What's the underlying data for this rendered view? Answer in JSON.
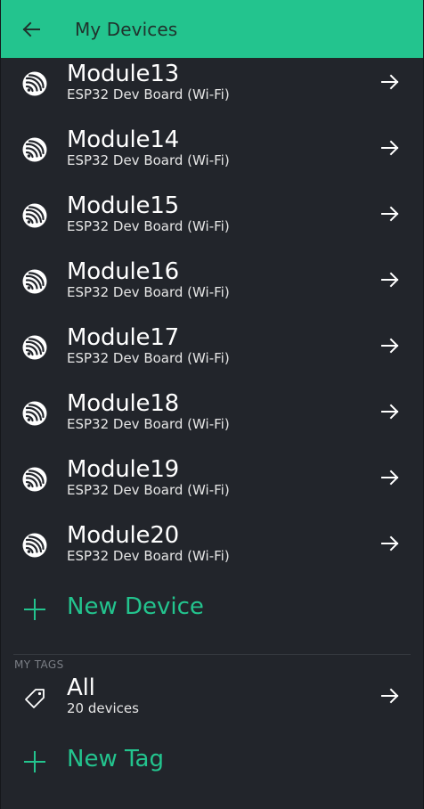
{
  "header": {
    "title": "My Devices",
    "back_icon": "arrow-left-icon",
    "background_color": "#23c48e",
    "title_color": "#20332d"
  },
  "devices": [
    {
      "name": "Module13",
      "board": "ESP32 Dev Board (Wi-Fi)"
    },
    {
      "name": "Module14",
      "board": "ESP32 Dev Board (Wi-Fi)"
    },
    {
      "name": "Module15",
      "board": "ESP32 Dev Board (Wi-Fi)"
    },
    {
      "name": "Module16",
      "board": "ESP32 Dev Board (Wi-Fi)"
    },
    {
      "name": "Module17",
      "board": "ESP32 Dev Board (Wi-Fi)"
    },
    {
      "name": "Module18",
      "board": "ESP32 Dev Board (Wi-Fi)"
    },
    {
      "name": "Module19",
      "board": "ESP32 Dev Board (Wi-Fi)"
    },
    {
      "name": "Module20",
      "board": "ESP32 Dev Board (Wi-Fi)"
    }
  ],
  "new_device": {
    "label": "New Device",
    "icon": "plus-icon"
  },
  "tags_section": {
    "label": "MY TAGS",
    "items": [
      {
        "name": "All",
        "count_label": "20 devices",
        "icon": "tag-icon"
      }
    ]
  },
  "new_tag": {
    "label": "New Tag",
    "icon": "plus-icon"
  },
  "colors": {
    "accent": "#23c48e",
    "background": "#22252b",
    "text_primary": "#ffffff",
    "text_secondary": "#e6e6e6",
    "section_label": "#7b7f86"
  }
}
